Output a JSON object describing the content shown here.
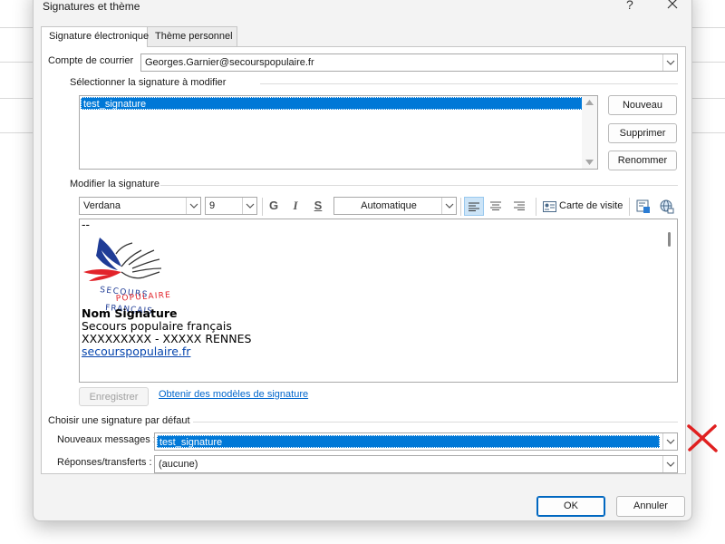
{
  "dialog": {
    "title": "Signatures et thème",
    "help": "?"
  },
  "tabs": [
    {
      "label": "Signature électronique",
      "active": true
    },
    {
      "label": "Thème personnel",
      "active": false
    }
  ],
  "account": {
    "label": "Compte de courrier",
    "value": "Georges.Garnier@secourspopulaire.fr"
  },
  "select_signature": {
    "label": "Sélectionner la signature à modifier",
    "items": [
      "test_signature"
    ],
    "selected": "test_signature"
  },
  "side_buttons": {
    "new": "Nouveau",
    "delete": "Supprimer",
    "rename": "Renommer"
  },
  "edit_signature": {
    "label": "Modifier la signature",
    "font": "Verdana",
    "size": "9",
    "bold": "G",
    "italic": "I",
    "underline": "S",
    "color": "Automatique",
    "business_card": "Carte de visite"
  },
  "signature_content": {
    "dashes": "--",
    "logo": {
      "line1": "SECOURS",
      "line2": "POPULAIRE",
      "line3": "FRANÇAIS"
    },
    "name": "Nom Signature",
    "org": "Secours populaire français",
    "address": "XXXXXXXXX - XXXXX RENNES",
    "website": "secourspopulaire.fr"
  },
  "save_button": "Enregistrer",
  "templates_link": "Obtenir des modèles de signature",
  "defaults": {
    "label": "Choisir une signature par défaut",
    "new_messages_label": "Nouveaux messages :",
    "new_messages_value": "test_signature",
    "replies_label": "Réponses/transferts :",
    "replies_value": "(aucune)"
  },
  "footer": {
    "ok": "OK",
    "cancel": "Annuler"
  },
  "colors": {
    "selection": "#0078d7",
    "annotation_x": "#e02020",
    "link": "#0066cc"
  }
}
